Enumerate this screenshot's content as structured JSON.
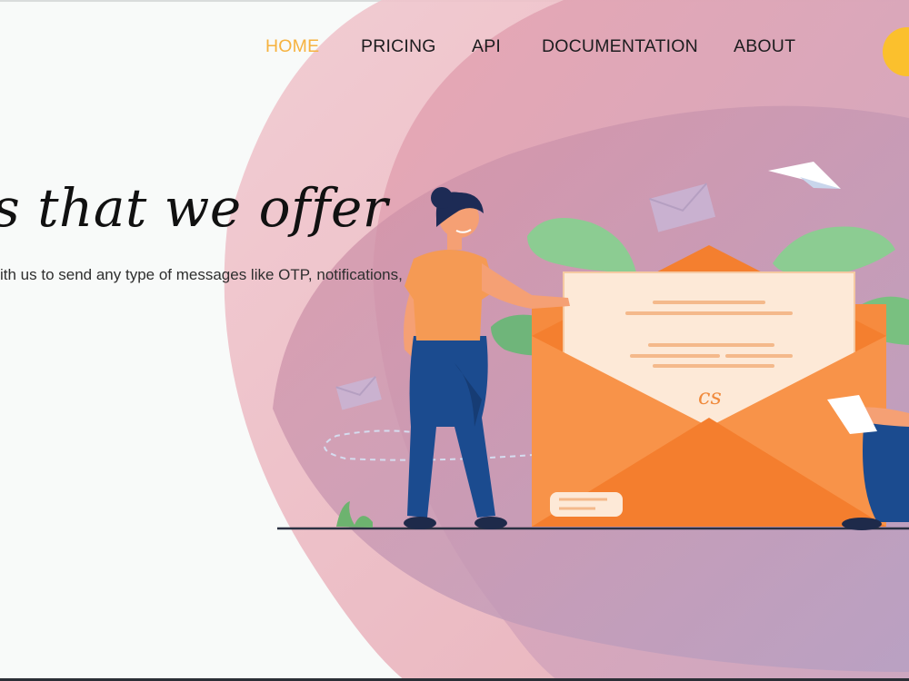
{
  "nav": {
    "items": [
      {
        "label": "HOME",
        "active": true
      },
      {
        "label": "PRICING",
        "active": false
      },
      {
        "label": "API",
        "active": false
      },
      {
        "label": "DOCUMENTATION",
        "active": false
      },
      {
        "label": "ABOUT",
        "active": false
      }
    ]
  },
  "hero": {
    "title": "s that we offer",
    "subtitle": "ith us to send any type of messages like OTP, notifications,"
  },
  "illustration": {
    "stamp_text": "cs"
  },
  "colors": {
    "accent": "#f6b23f",
    "user_circle": "#fbc02d",
    "envelope": "#f68b3f",
    "letter": "#fde9d7",
    "pants": "#1b4b8f",
    "shirt": "#f59a54",
    "leaf": "#8ccc92"
  }
}
